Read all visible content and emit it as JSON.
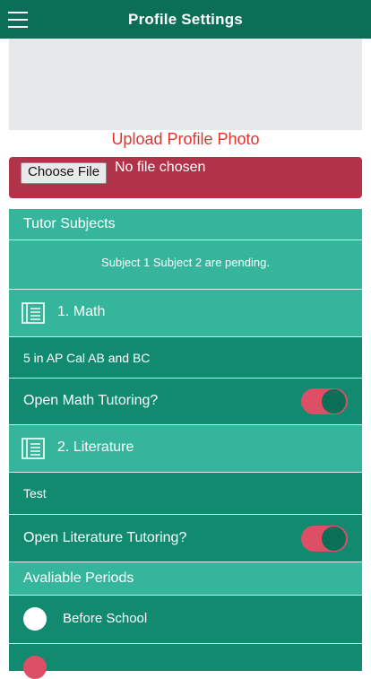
{
  "header": {
    "title": "Profile Settings",
    "menu_icon": "hamburger-menu-icon"
  },
  "profile_photo": {
    "upload_label": "Upload Profile Photo"
  },
  "file_input": {
    "button_label": "Choose File",
    "status": "No file chosen"
  },
  "subjects": {
    "header": "Tutor Subjects",
    "pending_text": "Subject 1 Subject 2 are pending.",
    "items": [
      {
        "label": "1. Math",
        "description": "5 in AP Cal AB and BC",
        "toggle_label": "Open Math Tutoring?",
        "toggle_on": true,
        "icon": "book-list-icon"
      },
      {
        "label": "2. Literature",
        "description": "Test",
        "toggle_label": "Open Literature Tutoring?",
        "toggle_on": true,
        "icon": "book-list-icon"
      }
    ]
  },
  "periods": {
    "header": "Avaliable Periods",
    "items": [
      {
        "label": "Before School",
        "selected": false
      }
    ]
  },
  "colors": {
    "topbar": "#0b6e57",
    "light_teal": "#35b59b",
    "dark_teal": "#128a70",
    "upload_red": "#e5322d",
    "file_box": "#b03349",
    "toggle_track": "#dd4f67"
  }
}
